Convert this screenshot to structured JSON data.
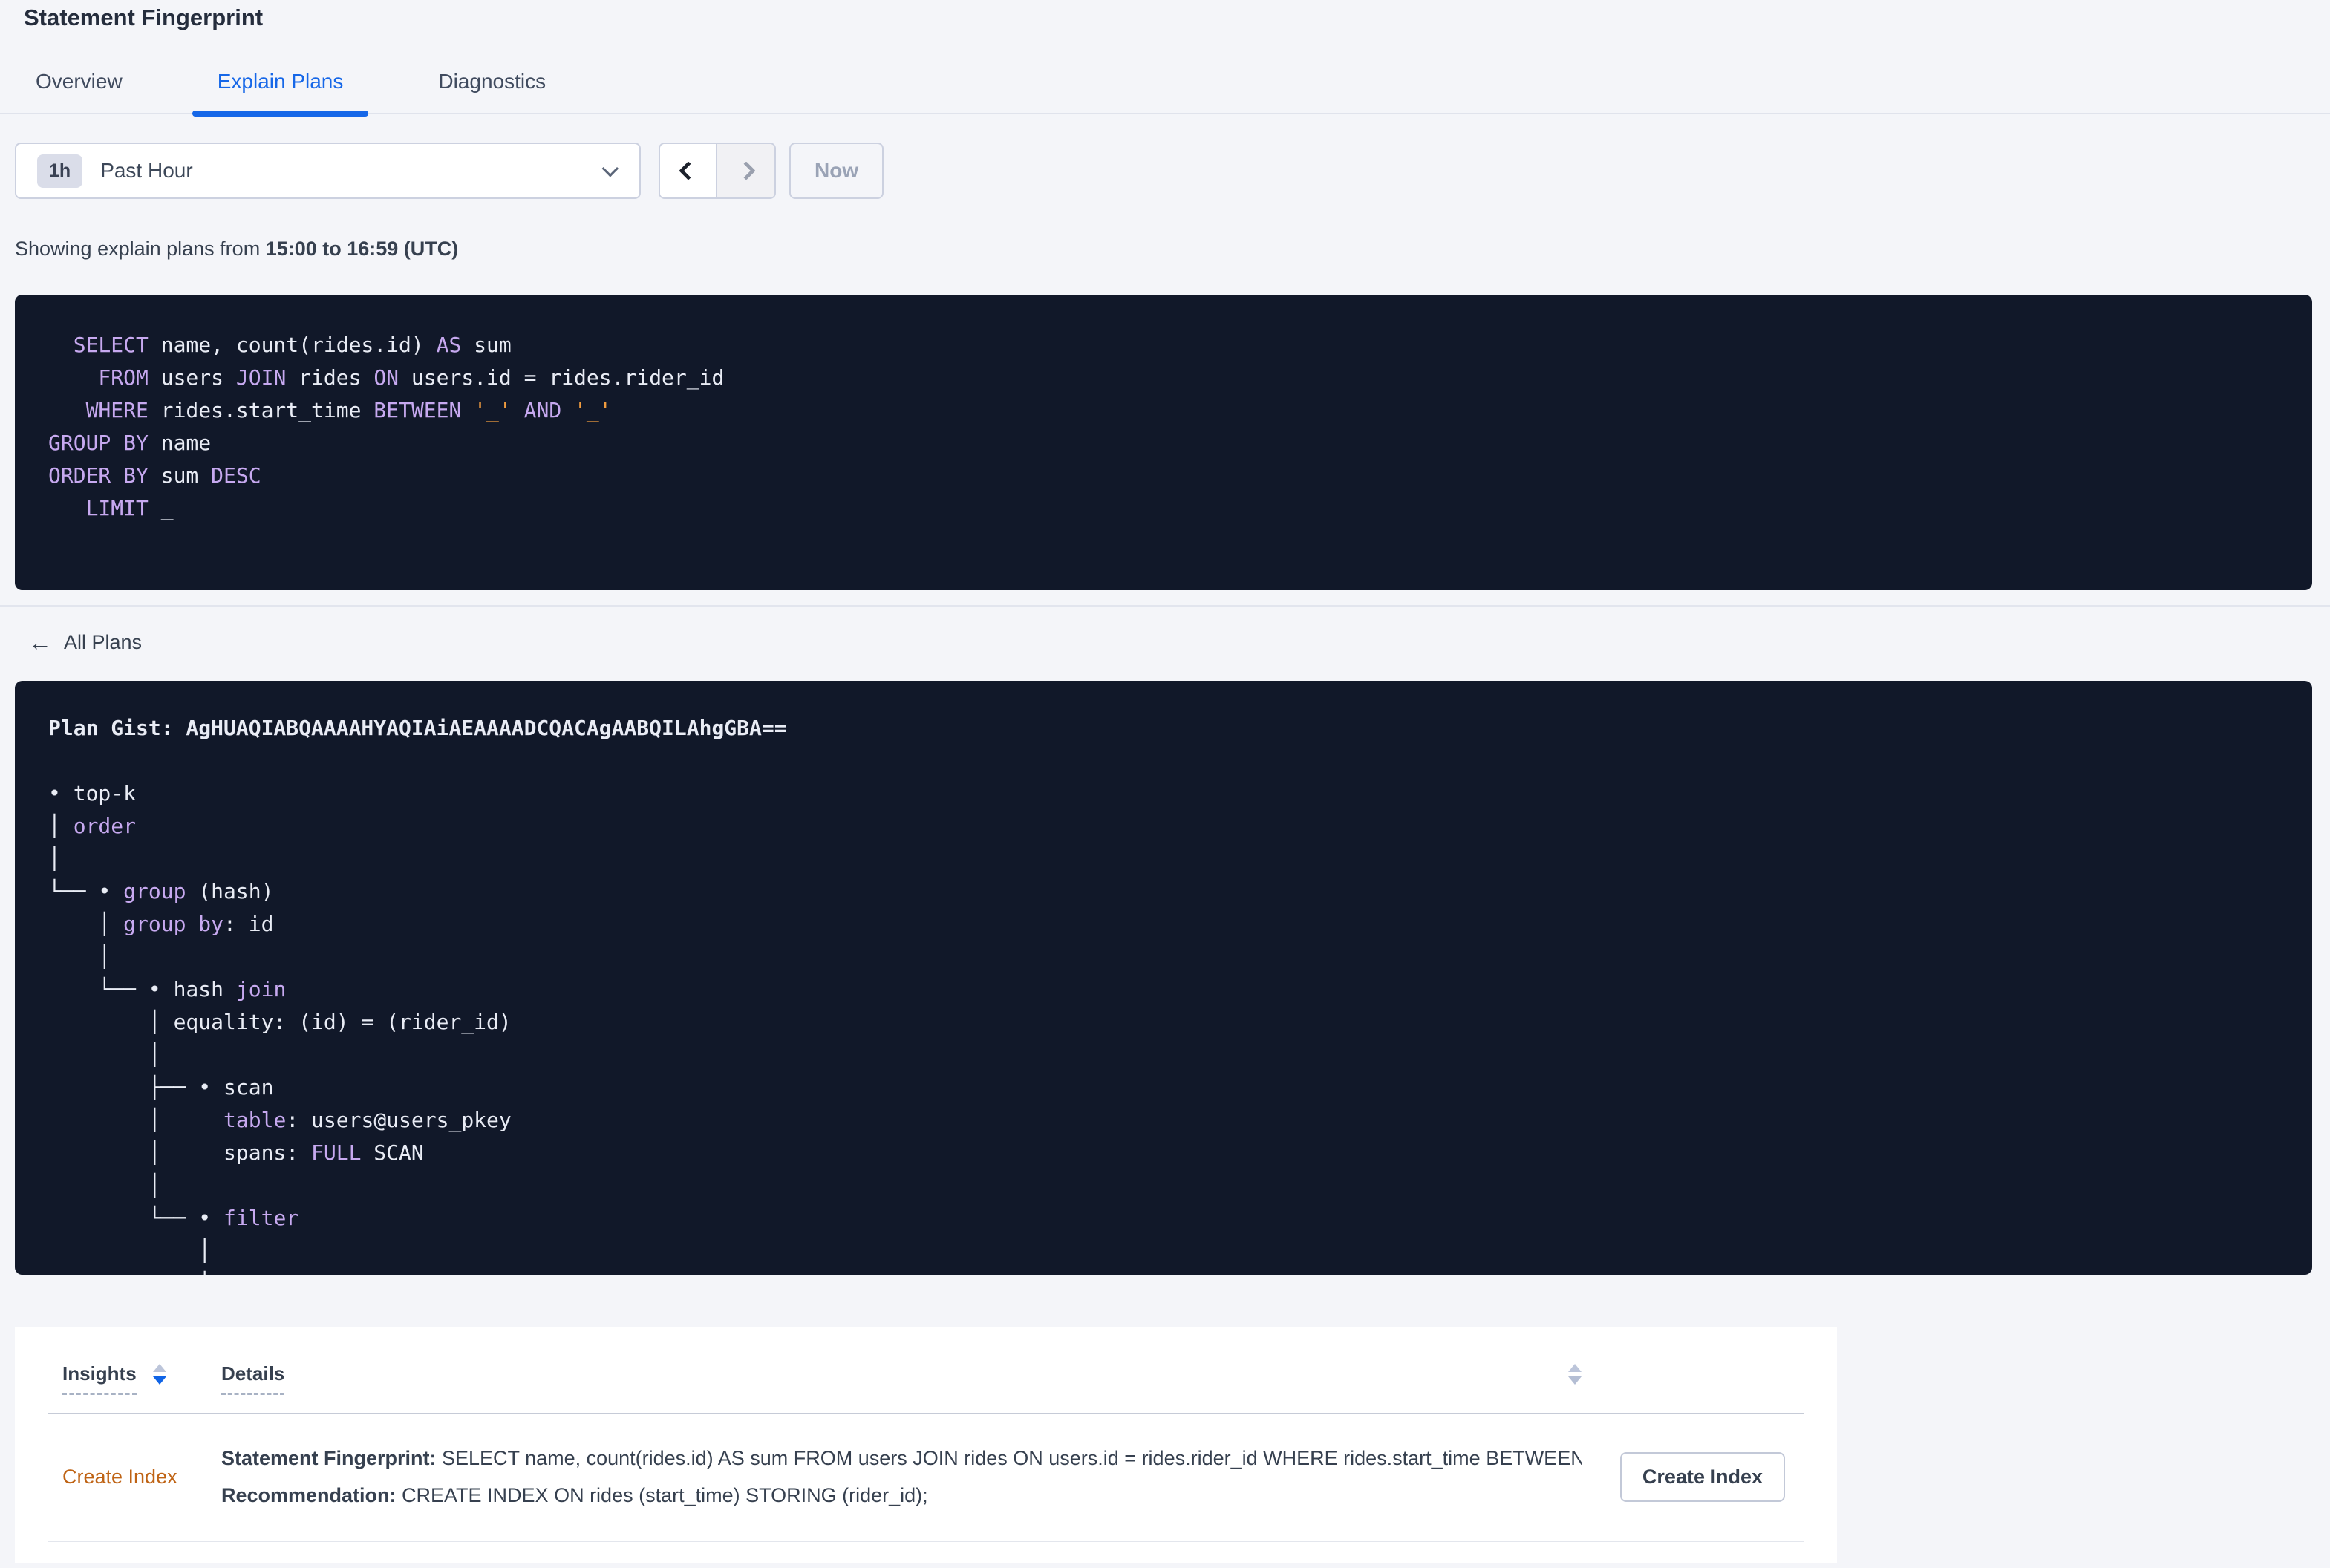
{
  "colors": {
    "accent_blue": "#1667e8",
    "sort_active_blue": "#1064e6",
    "code_background": "#111829",
    "code_keyword": "#c7a9f0",
    "code_literal": "#ef9b3f",
    "code_text": "#e9ecf5",
    "insight_link_orange": "#bf6314",
    "page_background": "#f4f5f9"
  },
  "header": {
    "title": "Statement Fingerprint"
  },
  "tabs": [
    {
      "label": "Overview"
    },
    {
      "label": "Explain Plans"
    },
    {
      "label": "Diagnostics"
    }
  ],
  "active_tab": "Explain Plans",
  "time_picker": {
    "badge": "1h",
    "selected": "Past Hour",
    "now_label": "Now"
  },
  "showing": {
    "prefix": "Showing explain plans from ",
    "bold_range": "15:00 to 16:59 (UTC)"
  },
  "sql_editor": {
    "lines": [
      [
        {
          "t": "kw",
          "s": "  SELECT"
        },
        {
          "s": " name, count(rides.id) "
        },
        {
          "t": "kw",
          "s": "AS"
        },
        {
          "s": " sum"
        }
      ],
      [
        {
          "t": "kw",
          "s": "    FROM"
        },
        {
          "s": " users "
        },
        {
          "t": "kw",
          "s": "JOIN"
        },
        {
          "s": " rides "
        },
        {
          "t": "kw",
          "s": "ON"
        },
        {
          "s": " users.id = rides.rider_id"
        }
      ],
      [
        {
          "t": "kw",
          "s": "   WHERE"
        },
        {
          "s": " rides.start_time "
        },
        {
          "t": "kw",
          "s": "BETWEEN"
        },
        {
          "s": " "
        },
        {
          "t": "lit",
          "s": "'_'"
        },
        {
          "s": " "
        },
        {
          "t": "kw",
          "s": "AND"
        },
        {
          "s": " "
        },
        {
          "t": "lit",
          "s": "'_'"
        }
      ],
      [
        {
          "t": "kw",
          "s": "GROUP BY"
        },
        {
          "s": " name"
        }
      ],
      [
        {
          "t": "kw",
          "s": "ORDER BY"
        },
        {
          "s": " sum "
        },
        {
          "t": "kw",
          "s": "DESC"
        }
      ],
      [
        {
          "t": "kw",
          "s": "   LIMIT"
        },
        {
          "s": " _"
        }
      ]
    ]
  },
  "plan_section": {
    "back_label": "All Plans",
    "gist": "AgHUAQIABQAAAAHYAQIAiAEAAAADCQACAgAABQILAhgGBA==",
    "lines": [
      [
        {
          "t": "b",
          "s": "Plan Gist: AgHUAQIABQAAAAHYAQIAiAEAAAADCQACAgAABQILAhgGBA=="
        }
      ],
      [],
      [
        {
          "s": "• top-k"
        }
      ],
      [
        {
          "s": "│ "
        },
        {
          "t": "kw",
          "s": "order"
        }
      ],
      [
        {
          "s": "│"
        }
      ],
      [
        {
          "s": "└── • "
        },
        {
          "t": "kw",
          "s": "group"
        },
        {
          "s": " (hash)"
        }
      ],
      [
        {
          "s": "    │ "
        },
        {
          "t": "kw",
          "s": "group by"
        },
        {
          "s": ": id"
        }
      ],
      [
        {
          "s": "    │"
        }
      ],
      [
        {
          "s": "    └── • hash "
        },
        {
          "t": "kw",
          "s": "join"
        }
      ],
      [
        {
          "s": "        │ equality: (id) = (rider_id)"
        }
      ],
      [
        {
          "s": "        │"
        }
      ],
      [
        {
          "s": "        ├── • scan"
        }
      ],
      [
        {
          "s": "        │     "
        },
        {
          "t": "kw",
          "s": "table"
        },
        {
          "s": ": users@users_pkey"
        }
      ],
      [
        {
          "s": "        │     spans: "
        },
        {
          "t": "kw",
          "s": "FULL"
        },
        {
          "s": " SCAN"
        }
      ],
      [
        {
          "s": "        │"
        }
      ],
      [
        {
          "s": "        └── • "
        },
        {
          "t": "kw",
          "s": "filter"
        }
      ],
      [
        {
          "s": "            │"
        }
      ],
      [
        {
          "s": "            │"
        }
      ]
    ]
  },
  "insights_table": {
    "col_insights": "Insights",
    "col_details": "Details",
    "row": {
      "insight_link": "Create Index",
      "fingerprint_label": "Statement Fingerprint:",
      "fingerprint_text": " SELECT name, count(rides.id) AS sum FROM users JOIN rides ON users.id = rides.rider_id WHERE rides.start_time BETWEEN '_...",
      "recommendation_label": "Recommendation:",
      "recommendation_text": " CREATE INDEX ON rides (start_time) STORING (rider_id);",
      "action_button": "Create Index"
    }
  }
}
